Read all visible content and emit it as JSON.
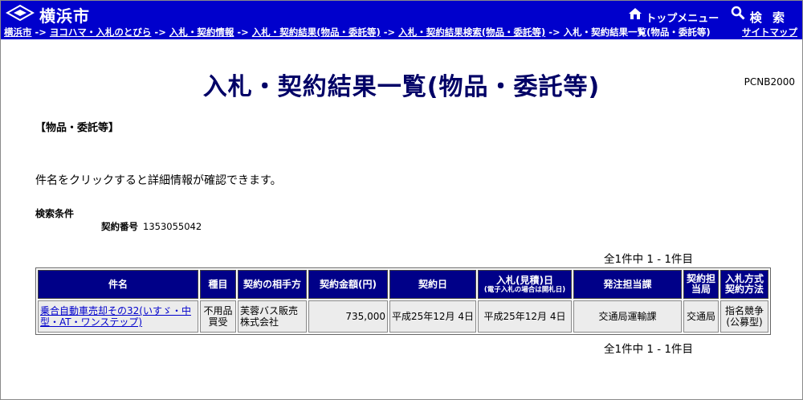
{
  "header": {
    "city_name": "横浜市",
    "top_menu_label": "トップメニュー",
    "search_label": "検 索"
  },
  "breadcrumb": {
    "items": [
      "横浜市",
      "ヨコハマ・入札のとびら",
      "入札・契約情報",
      "入札・契約結果(物品・委託等)",
      "入札・契約結果検索(物品・委託等)"
    ],
    "current": "入札・契約結果一覧(物品・委託等)",
    "separator": " -> ",
    "sitemap": "サイトマップ"
  },
  "page": {
    "title": "入札・契約結果一覧(物品・委託等)",
    "code": "PCNB2000",
    "section": "【物品・委託等】",
    "note": "件名をクリックすると詳細情報が確認できます。"
  },
  "search_conditions": {
    "label": "検索条件",
    "field_label": "契約番号",
    "field_value": "1353055042"
  },
  "results": {
    "count_text": "全1件中 1 - 1件目",
    "headers": {
      "subject": "件名",
      "category": "種目",
      "partner": "契約の相手方",
      "amount": "契約金額(円)",
      "contract_date": "契約日",
      "bid_date": "入札(見積)日",
      "bid_date_note": "(電子入札の場合は開札日)",
      "ordering_section": "発注担当課",
      "contract_bureau": "契約担当局",
      "method": "入札方式契約方法"
    },
    "rows": [
      {
        "subject": "乗合自動車売却その32(いすゞ・中型・AT・ワンステップ)",
        "category": "不用品買受",
        "partner": "芙蓉バス販売株式会社",
        "amount": "735,000",
        "contract_date": "平成25年12月 4日",
        "bid_date": "平成25年12月 4日",
        "ordering_section": "交通局運輸課",
        "contract_bureau": "交通局",
        "method": "指名競争(公募型)"
      }
    ]
  },
  "colors": {
    "header_blue": "#0000cc",
    "title_navy": "#000066",
    "table_header": "#000088",
    "cell_bg": "#ececec"
  }
}
